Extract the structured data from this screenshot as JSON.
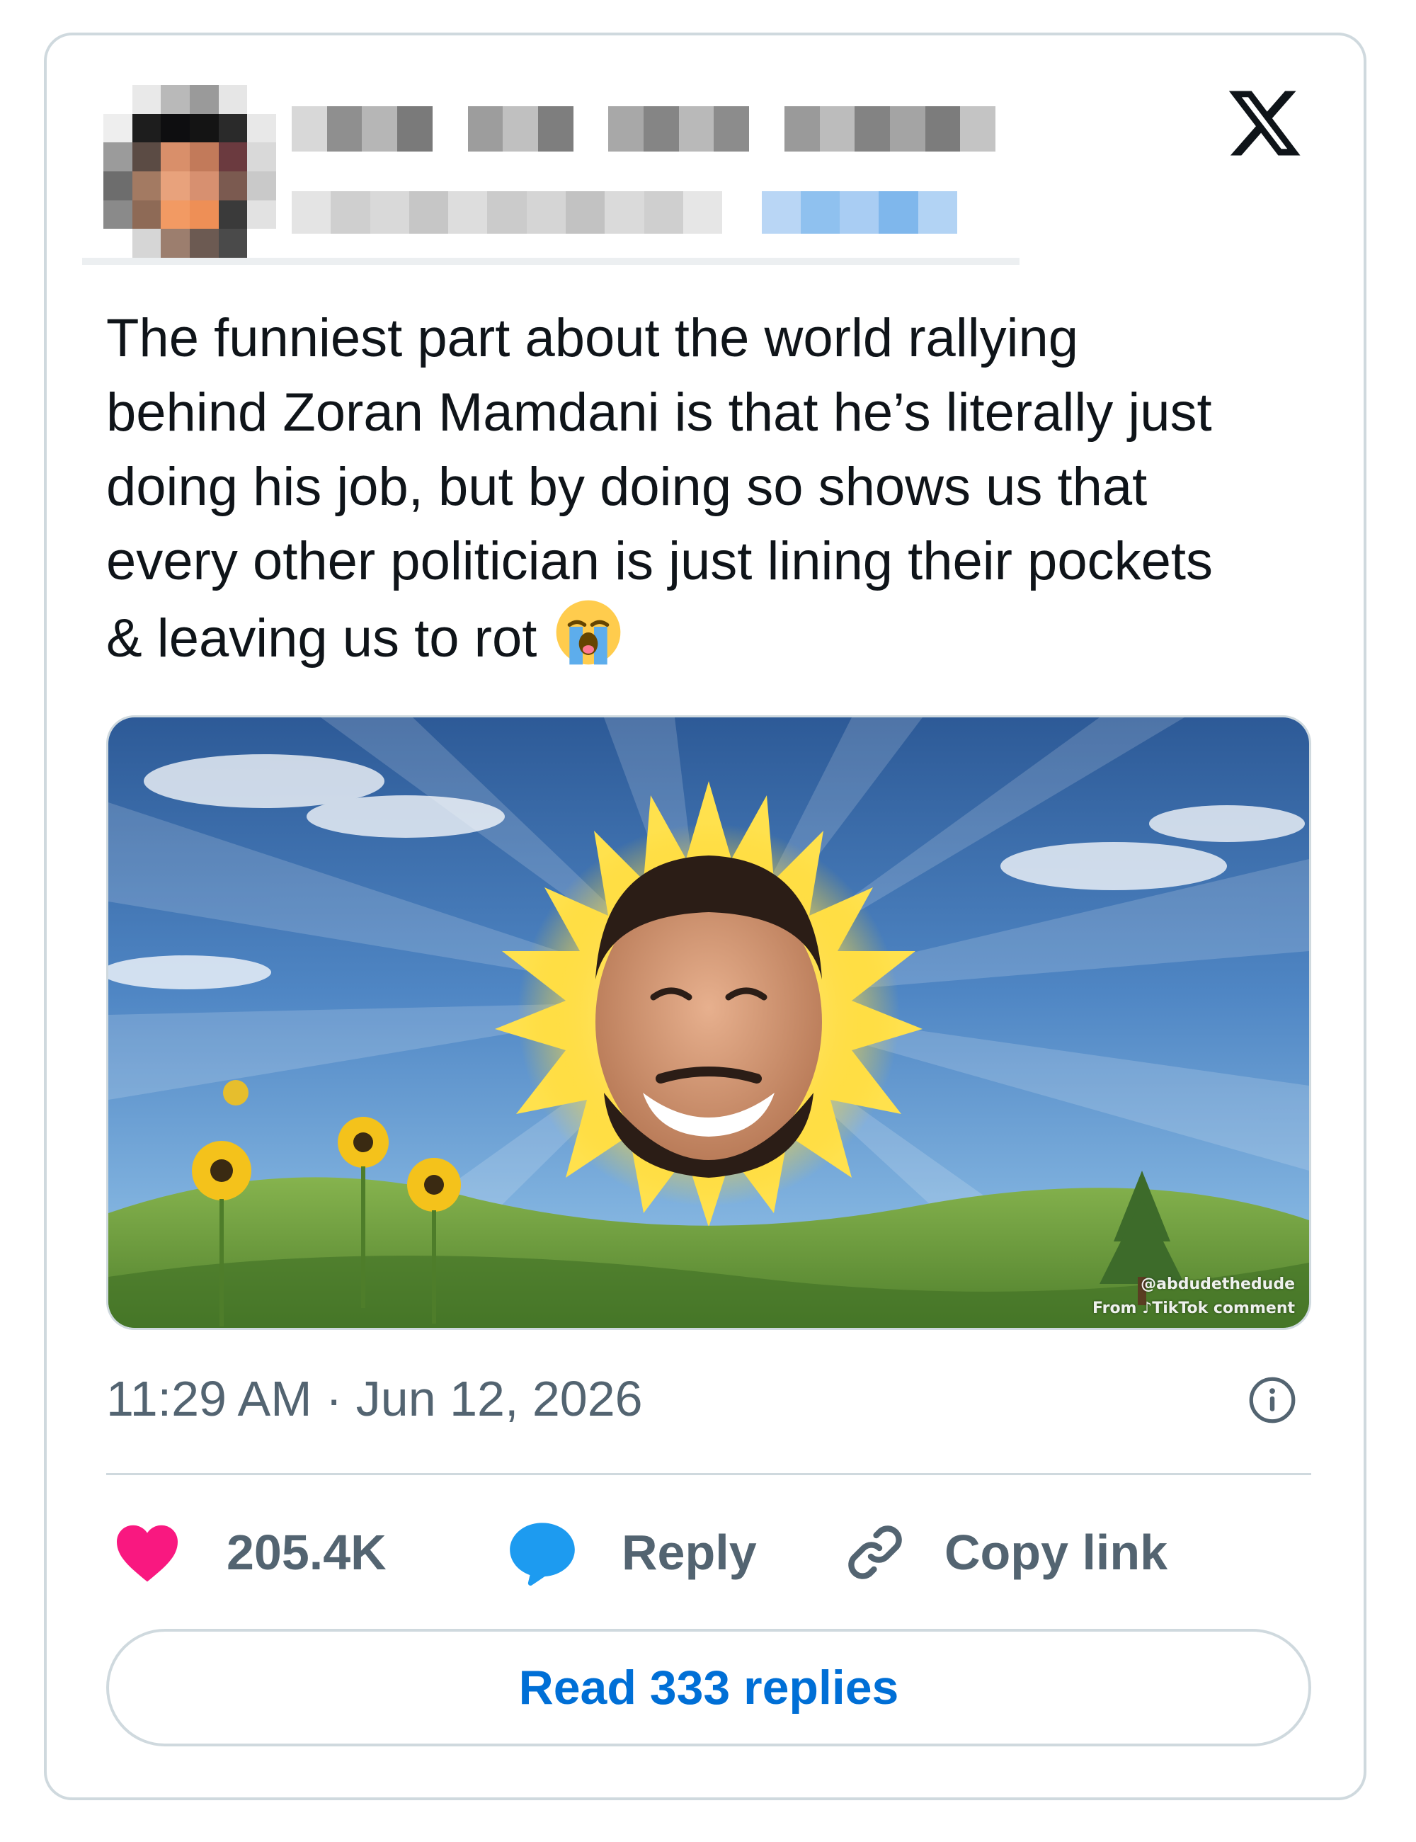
{
  "tweet": {
    "text": "The funniest part about the world rallying\nbehind Zoran Mamdani is that he’s literally just\ndoing his job, but by doing so shows us that\nevery other politician is just lining their pockets\n& leaving us to rot",
    "emoji_icon": "loudly-crying-face-emoji",
    "timestamp": "11:29 AM · Jun 12, 2026"
  },
  "media": {
    "watermark_handle": "@abdudethedude",
    "watermark_source_prefix": "From",
    "watermark_source_brand": "TikTok",
    "watermark_source_suffix": "comment"
  },
  "actions": {
    "like_count": "205.4K",
    "reply_label": "Reply",
    "copy_label": "Copy link",
    "read_replies_label": "Read 333 replies"
  },
  "icons": {
    "logo": "x-logo-icon",
    "info": "info-icon",
    "like": "heart-icon",
    "reply": "speech-bubble-icon",
    "copy": "link-icon"
  },
  "colors": {
    "like": "#f91880",
    "reply": "#1d9bf0",
    "link": "#006fd6",
    "secondary_text": "#536471",
    "border": "#cfd9de"
  }
}
